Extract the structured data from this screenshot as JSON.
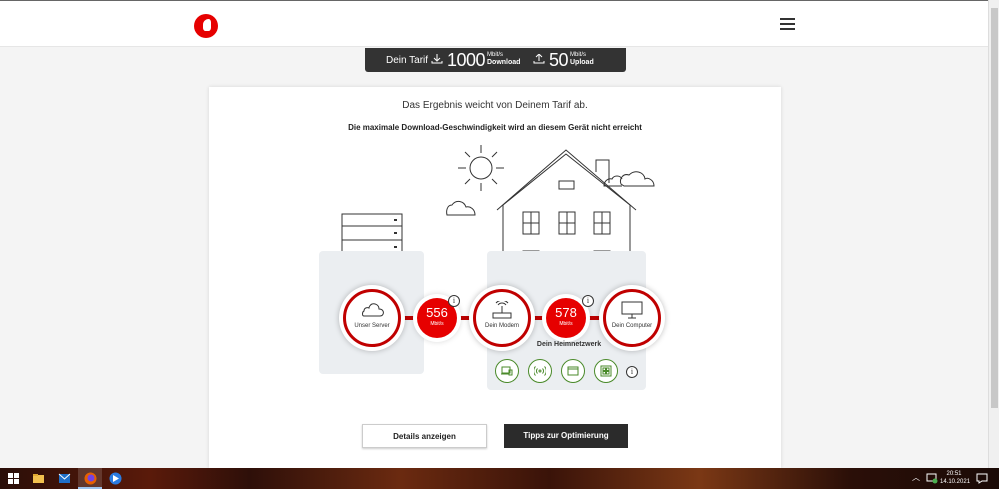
{
  "header": {
    "logo": "vodafone-logo",
    "menu_icon": "hamburger-icon"
  },
  "tarif": {
    "label": "Dein Tarif",
    "download_value": "1000",
    "download_unit": "Mbit/s",
    "download_label": "Download",
    "upload_value": "50",
    "upload_unit": "Mbit/s",
    "upload_label": "Upload"
  },
  "result": {
    "headline": "Das Ergebnis weicht von Deinem Tarif ab.",
    "subline": "Die maximale Download-Geschwindigkeit wird an diesem Gerät nicht erreicht"
  },
  "nodes": {
    "server_label": "Unser Server",
    "modem_label": "Dein Modem",
    "computer_label": "Dein Computer"
  },
  "speeds": {
    "server_modem_value": "556",
    "server_modem_unit": "Mbit/s",
    "modem_computer_value": "578",
    "modem_computer_unit": "Mbit/s"
  },
  "heimnetz_label": "Dein Heimnetzwerk",
  "info_glyph": "i",
  "buttons": {
    "details": "Details anzeigen",
    "tips": "Tipps zur Optimierung"
  },
  "taskbar": {
    "time": "20:51",
    "date": "14.10.2021"
  },
  "colors": {
    "accent": "#e60000",
    "ring": "#c00000",
    "device_green": "#4a8a2a",
    "dark": "#333333"
  }
}
